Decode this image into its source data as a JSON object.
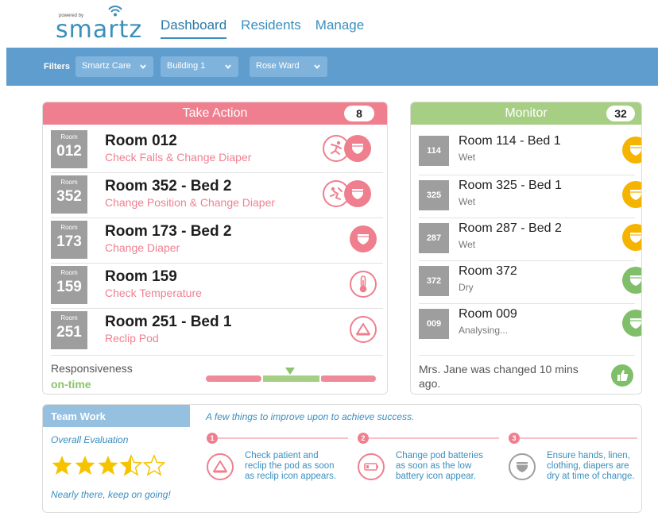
{
  "brand": {
    "powered_by": "powered by",
    "name": "smartz"
  },
  "nav": {
    "items": [
      "Dashboard",
      "Residents",
      "Manage"
    ],
    "active": "Dashboard"
  },
  "filters": {
    "label": "Filters",
    "selects": [
      "Smartz Care",
      "Building 1",
      "Rose Ward"
    ]
  },
  "take_action": {
    "title": "Take Action",
    "count": "8",
    "room_caption": "Room",
    "rows": [
      {
        "room": "012",
        "title": "Room 012",
        "subtitle": "Check Falls & Change Diaper",
        "icons": [
          "falls-icon",
          "diaper-icon"
        ]
      },
      {
        "room": "352",
        "title": "Room 352 - Bed 2",
        "subtitle": "Change Position & Change Diaper",
        "icons": [
          "position-icon",
          "diaper-icon"
        ]
      },
      {
        "room": "173",
        "title": "Room 173 - Bed 2",
        "subtitle": "Change Diaper",
        "icons": [
          "diaper-icon"
        ]
      },
      {
        "room": "159",
        "title": "Room 159",
        "subtitle": "Check Temperature",
        "icons": [
          "thermometer-icon"
        ]
      },
      {
        "room": "251",
        "title": "Room 251 - Bed 1",
        "subtitle": "Reclip Pod",
        "icons": [
          "reclip-icon"
        ]
      }
    ],
    "responsiveness": {
      "label": "Responsiveness",
      "status": "on-time"
    }
  },
  "monitor": {
    "title": "Monitor",
    "count": "32",
    "rows": [
      {
        "room": "114",
        "title": "Room 114 - Bed 1",
        "status": "Wet",
        "icon_color": "#f5b400"
      },
      {
        "room": "325",
        "title": "Room 325 - Bed 1",
        "status": "Wet",
        "icon_color": "#f5b400"
      },
      {
        "room": "287",
        "title": "Room 287 - Bed 2",
        "status": "Wet",
        "icon_color": "#f5b400"
      },
      {
        "room": "372",
        "title": "Room 372",
        "status": "Dry",
        "icon_color": "#7fbf6a"
      },
      {
        "room": "009",
        "title": "Room 009",
        "status": "Analysing...",
        "icon_color": "#7fbf6a"
      }
    ],
    "footer": "Mrs. Jane was changed 10 mins ago."
  },
  "team_work": {
    "title": "Team Work",
    "subtitle": "A few things to improve upon to achieve success.",
    "eval_label": "Overall Evaluation",
    "rating": 3.5,
    "rating_max": 5,
    "encouragement": "Nearly there, keep on going!",
    "tips": [
      {
        "num": "1",
        "text": "Check patient and reclip the pod as soon as reclip icon appears.",
        "icon": "reclip-icon"
      },
      {
        "num": "2",
        "text": "Change pod batteries as soon as the low battery icon appear.",
        "icon": "battery-icon"
      },
      {
        "num": "3",
        "text": "Ensure hands, linen, clothing, diapers are dry at time of change.",
        "icon": "diaper-icon"
      }
    ]
  },
  "colors": {
    "alert": "#ef7f8e",
    "monitor": "#a7cf84",
    "filterbar": "#5f9dce",
    "nav": "#3a8fc0",
    "wet": "#f5b400",
    "dry": "#7fbf6a",
    "star": "#f5c300"
  }
}
